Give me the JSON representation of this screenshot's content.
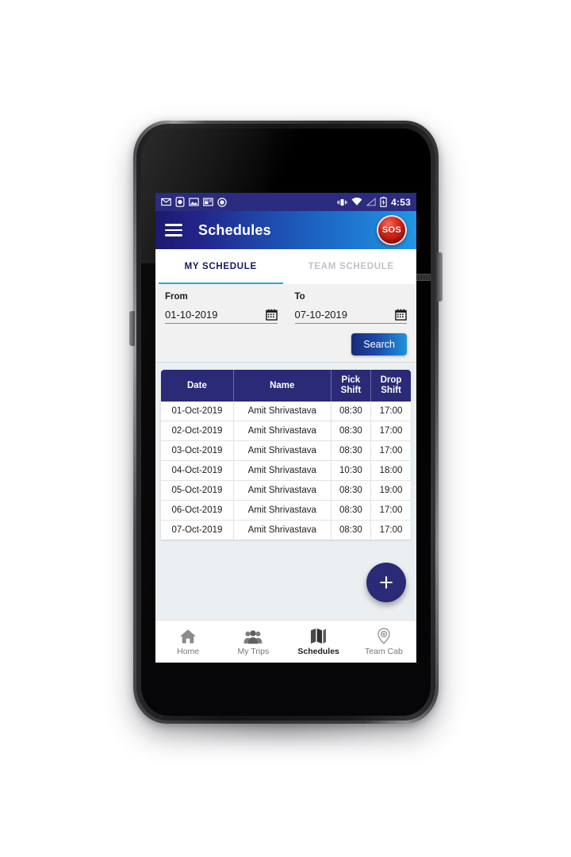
{
  "status_bar": {
    "time": "4:53",
    "left_icons": [
      "gmail-icon",
      "phone-contact-icon",
      "photo-icon",
      "news-icon",
      "circle-app-icon"
    ],
    "right_icons": [
      "vibrate-icon",
      "wifi-icon",
      "signal-icon",
      "battery-charging-icon"
    ]
  },
  "app_bar": {
    "title": "Schedules",
    "menu_icon": "hamburger-menu-icon",
    "sos_label": "SOS",
    "gradient_start": "#1b1b6f",
    "gradient_end": "#2196e3"
  },
  "tabs": [
    {
      "label": "MY SCHEDULE",
      "active": true
    },
    {
      "label": "TEAM SCHEDULE",
      "active": false
    }
  ],
  "filter": {
    "from_label": "From",
    "from_value": "01-10-2019",
    "to_label": "To",
    "to_value": "07-10-2019",
    "calendar_icon": "calendar-icon",
    "search_label": "Search"
  },
  "table": {
    "headers": [
      "Date",
      "Name",
      "Pick Shift",
      "Drop Shift"
    ],
    "rows": [
      {
        "date": "01-Oct-2019",
        "name": "Amit Shrivastava",
        "pick": "08:30",
        "drop": "17:00"
      },
      {
        "date": "02-Oct-2019",
        "name": "Amit Shrivastava",
        "pick": "08:30",
        "drop": "17:00"
      },
      {
        "date": "03-Oct-2019",
        "name": "Amit Shrivastava",
        "pick": "08:30",
        "drop": "17:00"
      },
      {
        "date": "04-Oct-2019",
        "name": "Amit Shrivastava",
        "pick": "10:30",
        "drop": "18:00"
      },
      {
        "date": "05-Oct-2019",
        "name": "Amit Shrivastava",
        "pick": "08:30",
        "drop": "19:00"
      },
      {
        "date": "06-Oct-2019",
        "name": "Amit Shrivastava",
        "pick": "08:30",
        "drop": "17:00"
      },
      {
        "date": "07-Oct-2019",
        "name": "Amit Shrivastava",
        "pick": "08:30",
        "drop": "17:00"
      }
    ]
  },
  "fab": {
    "icon": "plus-icon",
    "color": "#2a2a76"
  },
  "bottom_nav": [
    {
      "label": "Home",
      "icon": "home-icon",
      "active": false
    },
    {
      "label": "My Trips",
      "icon": "people-icon",
      "active": false
    },
    {
      "label": "Schedules",
      "icon": "map-icon",
      "active": true
    },
    {
      "label": "Team Cab",
      "icon": "location-pin-icon",
      "active": false
    }
  ]
}
